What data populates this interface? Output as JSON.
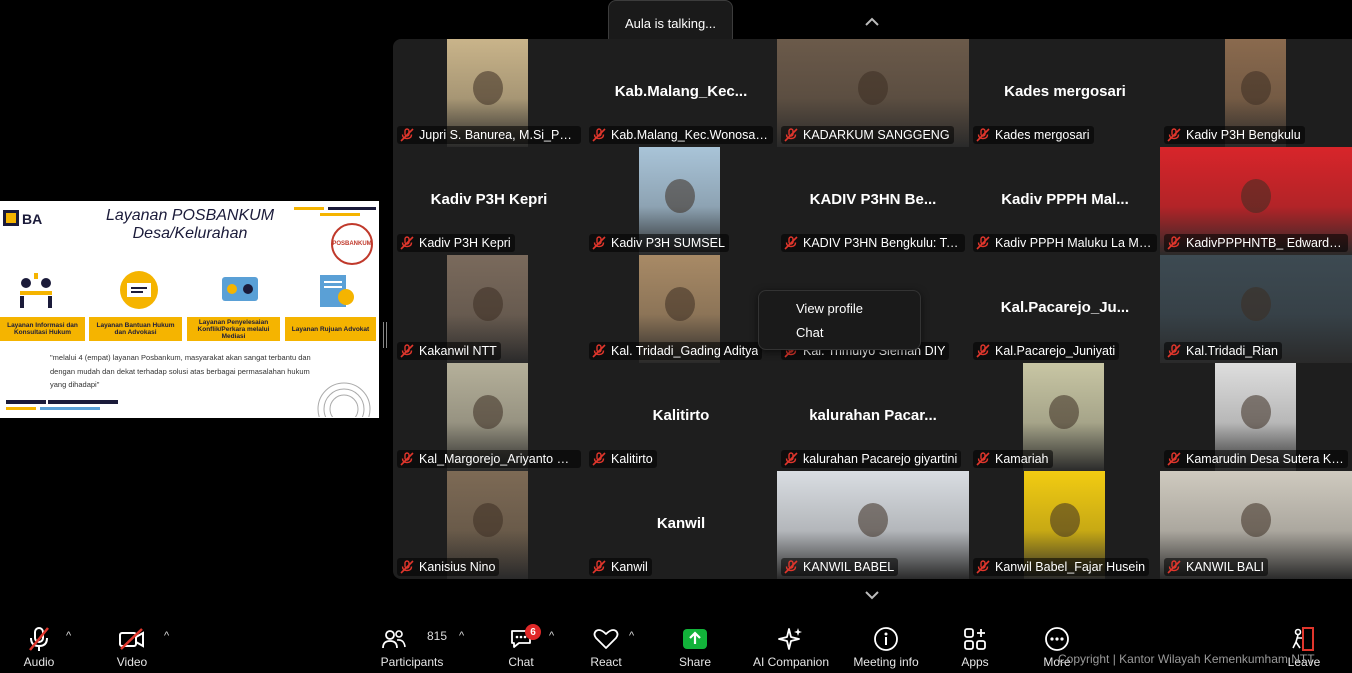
{
  "banner": {
    "talking": "Aula is talking..."
  },
  "share": {
    "title_line1": "Layanan POSBANKUM",
    "title_line2": "Desa/Kelurahan",
    "stamp": "POSBANKUM",
    "services": [
      "Layanan Informasi dan Konsultasi Hukum",
      "Layanan Bantuan Hukum dan Advokasi",
      "Layanan Penyelesaian Konflik/Perkara melalui Mediasi",
      "Layanan Rujuan Advokat"
    ],
    "quote": "\"melalui 4 (empat) layanan Posbankum, masyarakat akan sangat terbantu dan dengan mudah dan dekat terhadap solusi atas berbagai permasalahan hukum yang dihadapi\""
  },
  "tiles": [
    {
      "label": "Jupri S. Banurea, M.Si_Pos...",
      "big": "",
      "video": true,
      "tone": "#c9b48a"
    },
    {
      "label": "Kab.Malang_Kec.Wonosari...",
      "big": "Kab.Malang_Kec...",
      "video": false
    },
    {
      "label": "KADARKUM SANGGENG",
      "big": "",
      "video": true,
      "tone": "#6b5a4a"
    },
    {
      "label": "Kades mergosari",
      "big": "Kades mergosari",
      "video": false
    },
    {
      "label": "Kadiv P3H Bengkulu",
      "big": "",
      "video": true,
      "tone": "#8a6a4e"
    },
    {
      "label": "Kadiv P3H Kepri",
      "big": "Kadiv P3H Kepri",
      "video": false
    },
    {
      "label": "Kadiv P3H SUMSEL",
      "big": "",
      "video": true,
      "tone": "#a9c4d8"
    },
    {
      "label": "KADIV P3HN Bengkulu: Ton...",
      "big": "KADIV P3HN Be...",
      "video": false
    },
    {
      "label": "Kadiv PPPH Maluku La Mar...",
      "big": "Kadiv  PPPH  Mal...",
      "video": false
    },
    {
      "label": "KadivPPPHNTB_ Edward Ja...",
      "big": "",
      "video": true,
      "tone": "#d8252a"
    },
    {
      "label": "Kakanwil NTT",
      "big": "",
      "video": true,
      "tone": "#7a6a5c"
    },
    {
      "label": "Kal. Tridadi_Gading Aditya",
      "big": "",
      "video": true,
      "tone": "#a88a66"
    },
    {
      "label": "Kal. Trimulyo Sleman DIY",
      "big": "",
      "video": false
    },
    {
      "label": "Kal.Pacarejo_Juniyati",
      "big": "Kal.Pacarejo_Ju...",
      "video": false
    },
    {
      "label": "Kal.Tridadi_Rian",
      "big": "",
      "video": true,
      "tone": "#3d4a52"
    },
    {
      "label": "Kal_Margorejo_Ariyanto Wi...",
      "big": "",
      "video": true,
      "tone": "#b5b09a"
    },
    {
      "label": "Kalitirto",
      "big": "Kalitirto",
      "video": false
    },
    {
      "label": "kalurahan Pacarejo giyartini",
      "big": "kalurahan  Pacar...",
      "video": false
    },
    {
      "label": "Kamariah",
      "big": "",
      "video": true,
      "tone": "#c8c6a4"
    },
    {
      "label": "Kamarudin Desa Sutera Ke...",
      "big": "",
      "video": true,
      "tone": "#dedede"
    },
    {
      "label": "Kanisius Nino",
      "big": "",
      "video": true,
      "tone": "#7d6a55"
    },
    {
      "label": "Kanwil",
      "big": "Kanwil",
      "video": false
    },
    {
      "label": "KANWIL BABEL",
      "big": "",
      "video": true,
      "tone": "#d9dde2"
    },
    {
      "label": "Kanwil Babel_Fajar Husein",
      "big": "",
      "video": true,
      "tone": "#f2cc12"
    },
    {
      "label": "KANWIL BALI",
      "big": "",
      "video": true,
      "tone": "#cfcabf"
    }
  ],
  "context_menu": {
    "view_profile": "View profile",
    "chat": "Chat"
  },
  "toolbar": {
    "audio": "Audio",
    "video": "Video",
    "participants": "Participants",
    "participants_count": "815",
    "chat": "Chat",
    "chat_badge": "6",
    "react": "React",
    "share": "Share",
    "ai_companion": "AI Companion",
    "meeting_info": "Meeting info",
    "apps": "Apps",
    "more": "More",
    "leave": "Leave"
  },
  "watermark": "Copyright | Kantor Wilayah Kemenkumham NTT",
  "colors": {
    "accent_green": "#12b33a",
    "mute_red": "#e0362c",
    "badge_red": "#e02828",
    "tile_bg": "#1e1e1e",
    "slide_yellow": "#f5b400"
  }
}
